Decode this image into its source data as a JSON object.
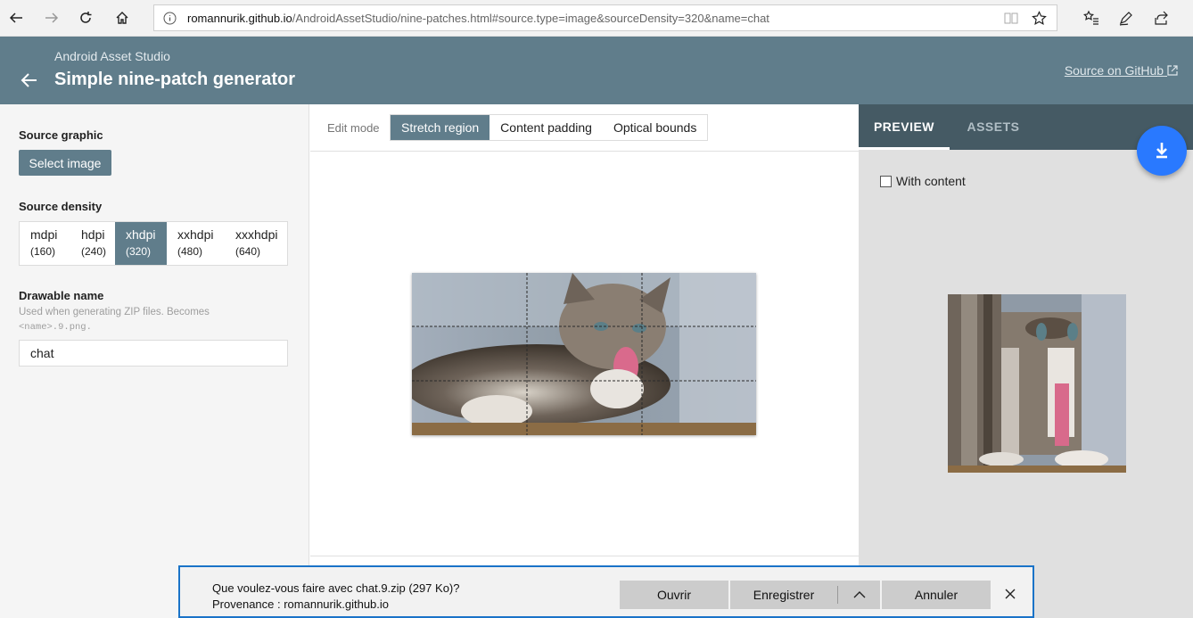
{
  "browser": {
    "url_host": "romannurik.github.io",
    "url_path": "/AndroidAssetStudio/nine-patches.html#source.type=image&sourceDensity=320&name=chat",
    "icons": [
      "back-icon",
      "forward-icon",
      "refresh-icon",
      "home-icon",
      "info-icon",
      "reading-view-icon",
      "favorite-star-icon",
      "favorites-hub-icon",
      "pen-icon",
      "share-icon"
    ]
  },
  "header": {
    "subtitle": "Android Asset Studio",
    "title": "Simple nine-patch generator",
    "github_link": "Source on GitHub",
    "color": "#607d8b"
  },
  "left": {
    "source_graphic_label": "Source graphic",
    "select_image_button": "Select image",
    "source_density_label": "Source density",
    "densities": [
      {
        "name": "mdpi",
        "value": "(160)"
      },
      {
        "name": "hdpi",
        "value": "(240)"
      },
      {
        "name": "xhdpi",
        "value": "(320)"
      },
      {
        "name": "xxhdpi",
        "value": "(480)"
      },
      {
        "name": "xxxhdpi",
        "value": "(640)"
      }
    ],
    "selected_density": "xhdpi",
    "drawable_name_label": "Drawable name",
    "drawable_help_1": "Used when generating ZIP files. Becomes",
    "drawable_help_code": "<name>.9.png.",
    "drawable_name_value": "chat"
  },
  "center": {
    "edit_mode_label": "Edit mode",
    "modes": [
      "Stretch region",
      "Content padding",
      "Optical bounds"
    ],
    "selected_mode": "Stretch region"
  },
  "right": {
    "tabs": [
      "PREVIEW",
      "ASSETS"
    ],
    "selected_tab": "PREVIEW",
    "with_content_label": "With content",
    "with_content_checked": false,
    "fab_icon": "download-icon",
    "fab_color": "#2979ff"
  },
  "download": {
    "question": "Que voulez-vous faire avec chat.9.zip (297 Ko)?",
    "source": "Provenance : romannurik.github.io",
    "open_button": "Ouvrir",
    "save_button": "Enregistrer",
    "cancel_button": "Annuler"
  }
}
